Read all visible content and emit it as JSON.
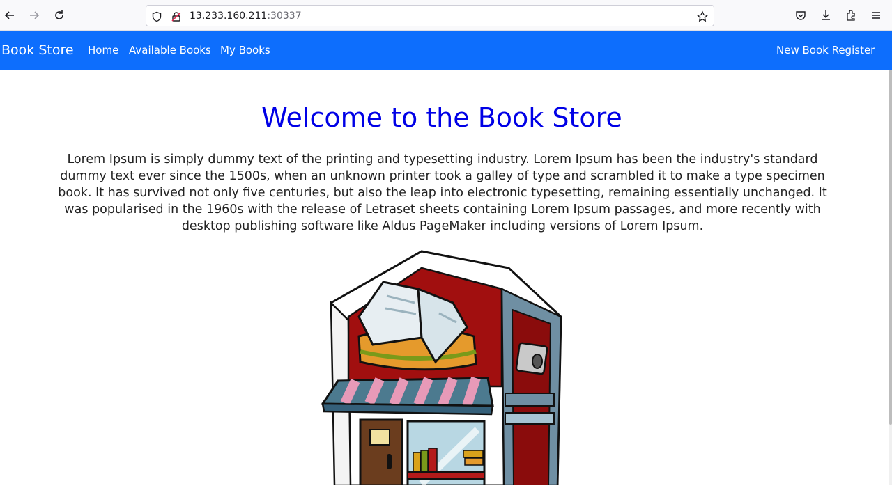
{
  "browser": {
    "url_host": "13.233.160.211",
    "url_port": ":30337",
    "icons": [
      "back-icon",
      "forward-icon",
      "reload-icon",
      "shield-icon",
      "insecure-lock-icon",
      "bookmark-star-icon",
      "pocket-icon",
      "download-icon",
      "extensions-icon",
      "menu-icon"
    ]
  },
  "navbar": {
    "brand": "Book Store",
    "links": [
      "Home",
      "Available Books",
      "My Books"
    ],
    "right_link": "New Book Register",
    "bg_color": "#0d6efd"
  },
  "main": {
    "title": "Welcome to the Book Store",
    "title_color": "#0000e6",
    "description": "Lorem Ipsum is simply dummy text of the printing and typesetting industry. Lorem Ipsum has been the industry's standard dummy text ever since the 1500s, when an unknown printer took a galley of type and scrambled it to make a type specimen book. It has survived not only five centuries, but also the leap into electronic typesetting, remaining essentially unchanged. It was popularised in the 1960s with the release of Letraset sheets containing Lorem Ipsum passages, and more recently with desktop publishing software like Aldus PageMaker including versions of Lorem Ipsum.",
    "image": "bookstore-illustration"
  }
}
